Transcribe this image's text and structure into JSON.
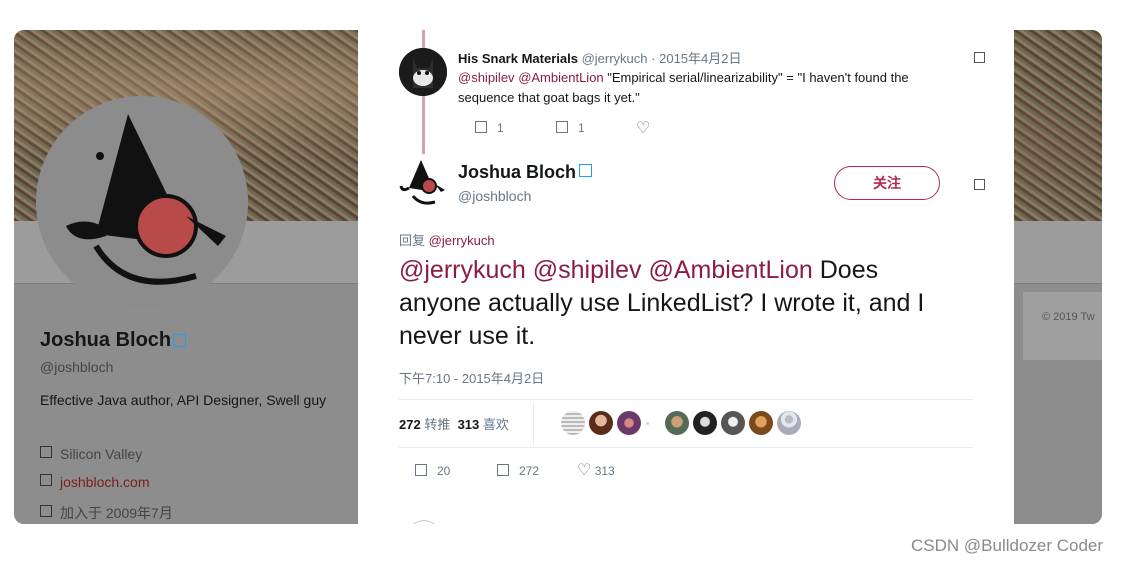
{
  "background_profile": {
    "name": "Joshua Bloch",
    "handle": "@joshbloch",
    "bio": "Effective Java author, API Designer, Swell guy",
    "location": "Silicon Valley",
    "website": "joshbloch.com",
    "joined": "加入于 2009年7月",
    "copyright": "© 2019 Tw"
  },
  "parent_tweet": {
    "author_name": "His Snark Materials",
    "author_handle": "@jerrykuch",
    "separator": "·",
    "date": "2015年4月2日",
    "mention1": "@shipilev",
    "mention2": "@AmbientLion",
    "text": " \"Empirical serial/linearizability\" = \"I haven't found the sequence that goat bags it yet.\"",
    "reply_count": "1",
    "retweet_count": "1"
  },
  "main_tweet": {
    "author_name": "Joshua Bloch",
    "author_handle": "@joshbloch",
    "follow_label": "关注",
    "reply_to_label": "回复",
    "reply_to_handle": "@jerrykuch",
    "mentions": "@jerrykuch @shipilev @AmbientLion",
    "text": " Does anyone actually use LinkedList?  I wrote it, and I never use it.",
    "timestamp": "下午7:10 - 2015年4月2日",
    "retweets_count": "272",
    "retweets_label": "转推",
    "likes_count": "313",
    "likes_label": "喜欢",
    "reply_count": "20",
    "retweet_count": "272",
    "like_count": "313"
  },
  "watermark": "CSDN @Bulldozer Coder",
  "colors": {
    "mention": "#8b1e3f",
    "follow_border": "#b02a4e",
    "thread_line": "#d6a0ad",
    "secondary_text": "#657786"
  }
}
